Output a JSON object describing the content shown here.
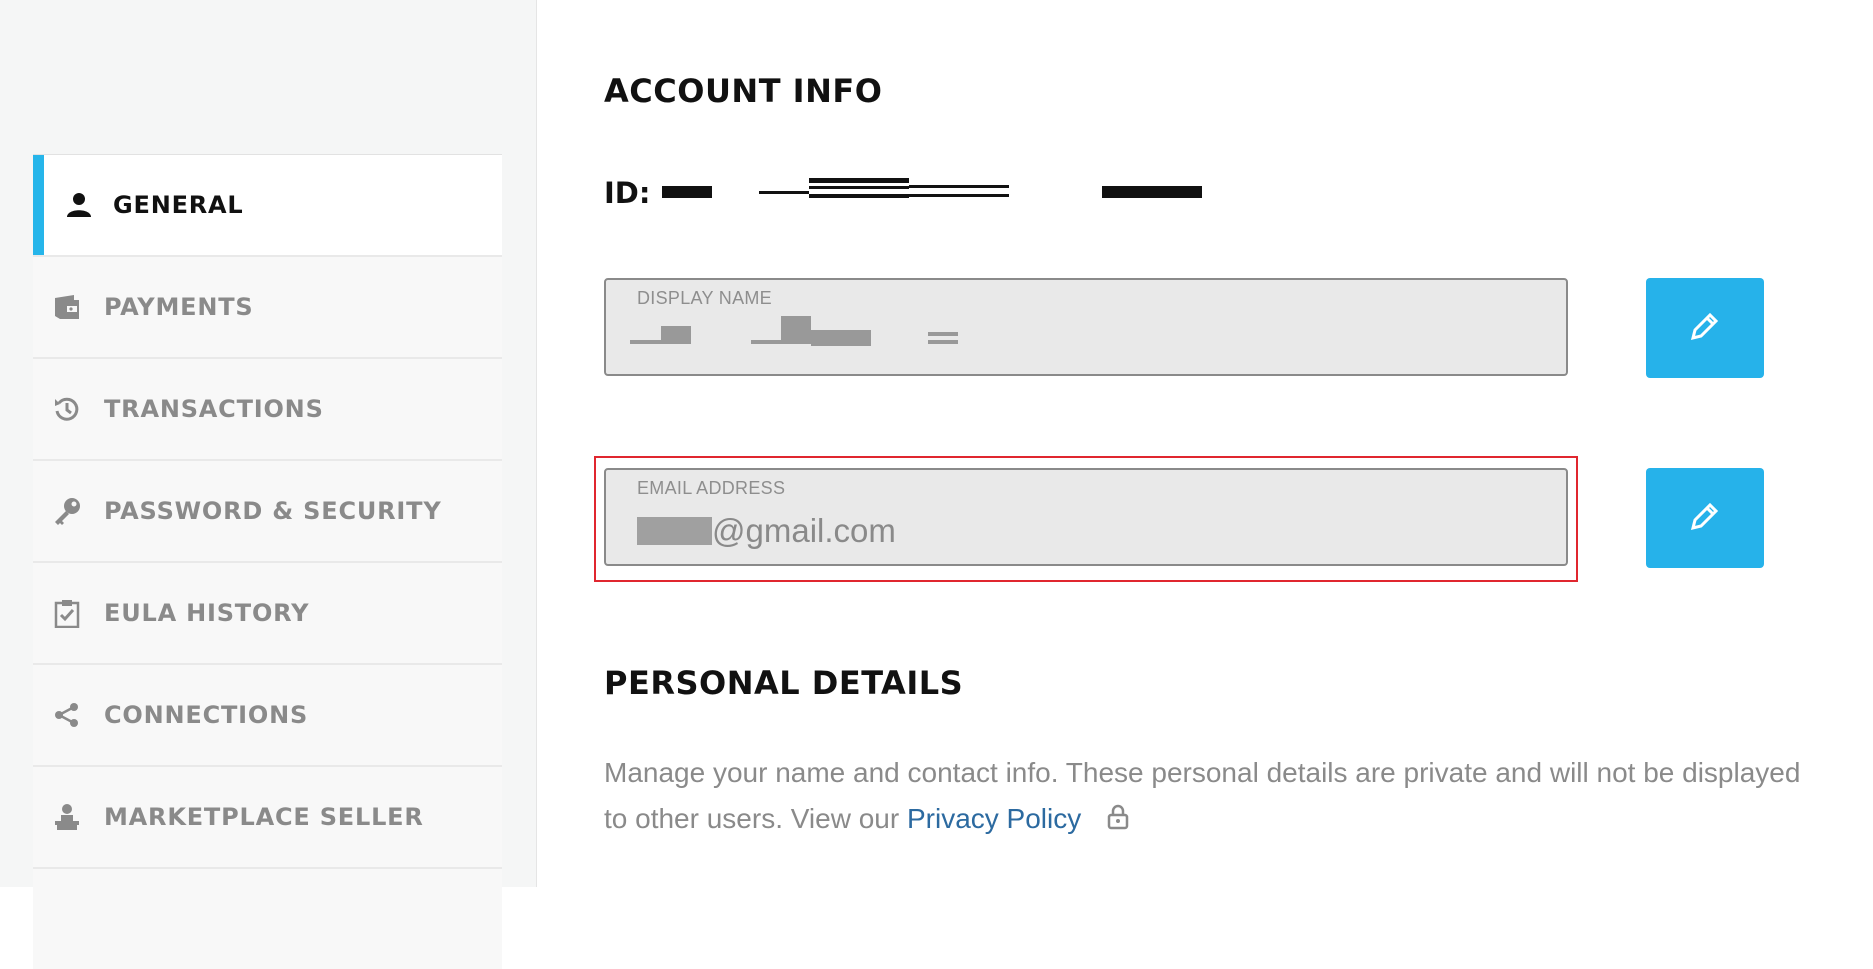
{
  "sidebar": {
    "items": [
      {
        "label": "GENERAL",
        "icon": "user-icon",
        "active": true
      },
      {
        "label": "PAYMENTS",
        "icon": "wallet-icon",
        "active": false
      },
      {
        "label": "TRANSACTIONS",
        "icon": "history-icon",
        "active": false
      },
      {
        "label": "PASSWORD & SECURITY",
        "icon": "key-icon",
        "active": false
      },
      {
        "label": "EULA HISTORY",
        "icon": "clipboard-check-icon",
        "active": false
      },
      {
        "label": "CONNECTIONS",
        "icon": "share-icon",
        "active": false
      },
      {
        "label": "MARKETPLACE SELLER",
        "icon": "seller-icon",
        "active": false
      }
    ]
  },
  "account_info": {
    "title": "ACCOUNT INFO",
    "id_label": "ID:",
    "display_name": {
      "label": "DISPLAY NAME"
    },
    "email": {
      "label": "EMAIL ADDRESS",
      "value_suffix": "@gmail.com"
    }
  },
  "personal_details": {
    "title": "PERSONAL DETAILS",
    "description": "Manage your name and contact info. These personal details are private and will not be displayed to other users. View our",
    "link_text": "Privacy Policy"
  },
  "colors": {
    "accent": "#26b5ea",
    "edit_button": "#26b2ea",
    "highlight_border": "#e0262f",
    "link": "#2c6aa0"
  }
}
